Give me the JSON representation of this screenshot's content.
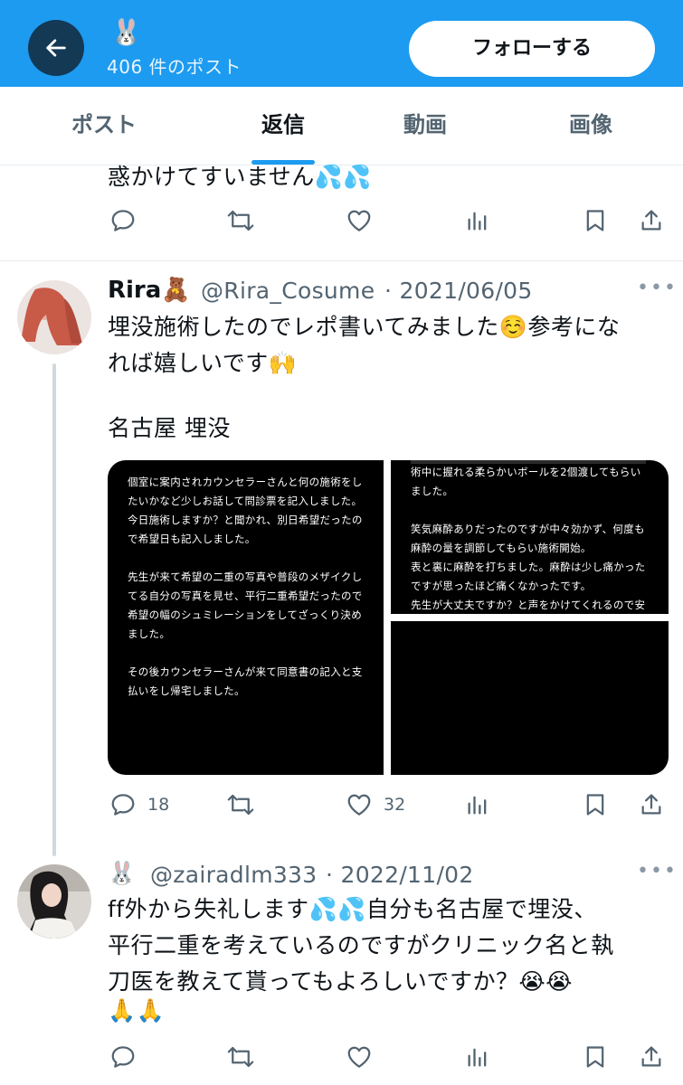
{
  "header": {
    "profile_emoji": "🐰",
    "post_count": "406 件のポスト",
    "follow_label": "フォローする"
  },
  "tabs": [
    {
      "label": "ポスト",
      "active": false
    },
    {
      "label": "返信",
      "active": true
    },
    {
      "label": "動画",
      "active": false
    },
    {
      "label": "画像",
      "active": false
    }
  ],
  "prev_tweet": {
    "text_tail": "惑かけてすいません💦💦"
  },
  "tweet1": {
    "display_name": "Rira🧸",
    "handle": "@Rira_Cosume",
    "date": "· 2021/06/05",
    "text_line1": "埋没施術したのでレポ書いてみました☺️参考にな",
    "text_line2": "れば嬉しいです🙌",
    "text_line3": "名古屋 埋没",
    "image1_text": "個室に案内されカウンセラーさんと何の施術をし\nたいかなど少しお話して問診票を記入しました。\n今日施術しますか？と聞かれ、別日希望だったの\nで希望日も記入しました。\n\n先生が来て希望の二重の写真や普段のメザイクし\nてる自分の写真を見せ、平行二重希望だったので\n希望の幅のシュミレーションをしてざっくり決め\nました。\n\nその後カウンセラーさんが来て同意書の記入と支\n払いをし帰宅しました。",
    "image2_text": "術中に握れる柔らかいボールを2個渡してもらい\nました。\n\n笑気麻酔ありだったのですが中々効かず、何度も\n麻酔の量を調節してもらい施術開始。\n表と裏に麻酔を打ちました。麻酔は少し痛かった\nですが思ったほど痛くなかったです。\n先生が大丈夫ですか？と声をかけてくれるので安\n心しました。",
    "reply_count": "18",
    "like_count": "32"
  },
  "tweet2": {
    "display_name": "🐰",
    "handle": "@zairadlm333",
    "date": "· 2022/11/02",
    "text_line1": "ff外から失礼します💦💦自分も名古屋で埋没、",
    "text_line2": "平行二重を考えているのですがクリニック名と執",
    "text_line3": "刀医を教えて貰ってもよろしいですか？😭😭",
    "text_line4": "🙏🙏"
  },
  "colors": {
    "accent": "#1d9bf0",
    "text": "#0f1419",
    "secondary": "#536471"
  }
}
